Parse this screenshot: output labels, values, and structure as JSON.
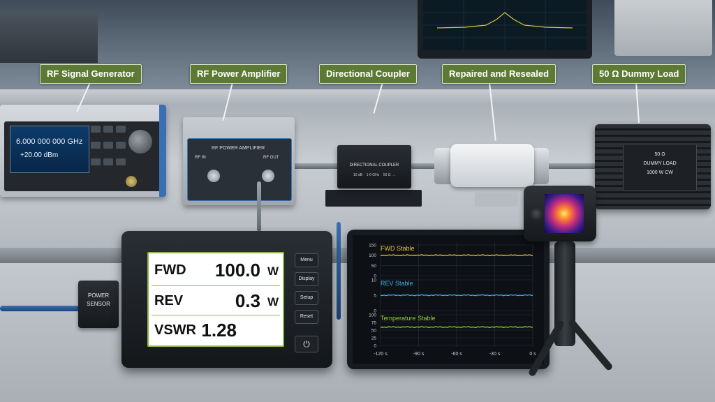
{
  "labels": {
    "signal_generator": "RF Signal Generator",
    "power_amplifier": "RF Power Amplifier",
    "directional_coupler": "Directional Coupler",
    "repaired": "Repaired and Resealed",
    "dummy_load": "50 Ω Dummy Load"
  },
  "signal_generator": {
    "frequency": "6.000 000 000 GHz",
    "power": "+20.00 dBm"
  },
  "amplifier": {
    "title": "RF POWER AMPLIFIER",
    "rf_in": "RF IN",
    "rf_out": "RF OUT"
  },
  "coupler": {
    "title": "DIRECTIONAL COUPLER",
    "coupling": "10 dB",
    "band": "1-6 GHz",
    "impedance": "50 Ω"
  },
  "dummy_load": {
    "line1": "50 Ω",
    "line2": "DUMMY LOAD",
    "line3": "1000 W CW"
  },
  "power_sensor": {
    "line1": "POWER",
    "line2": "SENSOR"
  },
  "meter": {
    "fwd": {
      "tag": "FWD",
      "value": "100.0",
      "unit": "W"
    },
    "rev": {
      "tag": "REV",
      "value": "0.3",
      "unit": "W"
    },
    "vswr": {
      "tag": "VSWR",
      "value": "1.28"
    },
    "buttons": {
      "menu": "Menu",
      "display": "Display",
      "setup": "Setup",
      "reset": "Reset",
      "power": "⏻"
    }
  },
  "chart_data": {
    "type": "line",
    "x": [
      -120,
      -90,
      -60,
      -30,
      0
    ],
    "x_tick_labels": [
      "-120 s",
      "-90 s",
      "-60 s",
      "-30 s",
      "0 s"
    ],
    "xlim": [
      -120,
      0
    ],
    "grid": true,
    "panels": [
      {
        "title": "FWD Stable",
        "color": "#e8c63a",
        "ylim": [
          0,
          150
        ],
        "yticks": [
          0,
          50,
          100,
          150
        ],
        "level": 100
      },
      {
        "title": "REV Stable",
        "color": "#3fb4e6",
        "ylim": [
          0,
          10
        ],
        "yticks": [
          0,
          5,
          10
        ],
        "level": 5
      },
      {
        "title": "Temperature Stable",
        "color": "#8bd43a",
        "ylim": [
          0,
          100
        ],
        "yticks": [
          0,
          25,
          50,
          75,
          100
        ],
        "level": 60
      }
    ]
  },
  "colors": {
    "label_bg": "#5d7a35",
    "meter_frame": "#8fb84f",
    "fwd_trace": "#e8c63a",
    "rev_trace": "#3fb4e6",
    "temp_trace": "#8bd43a"
  }
}
